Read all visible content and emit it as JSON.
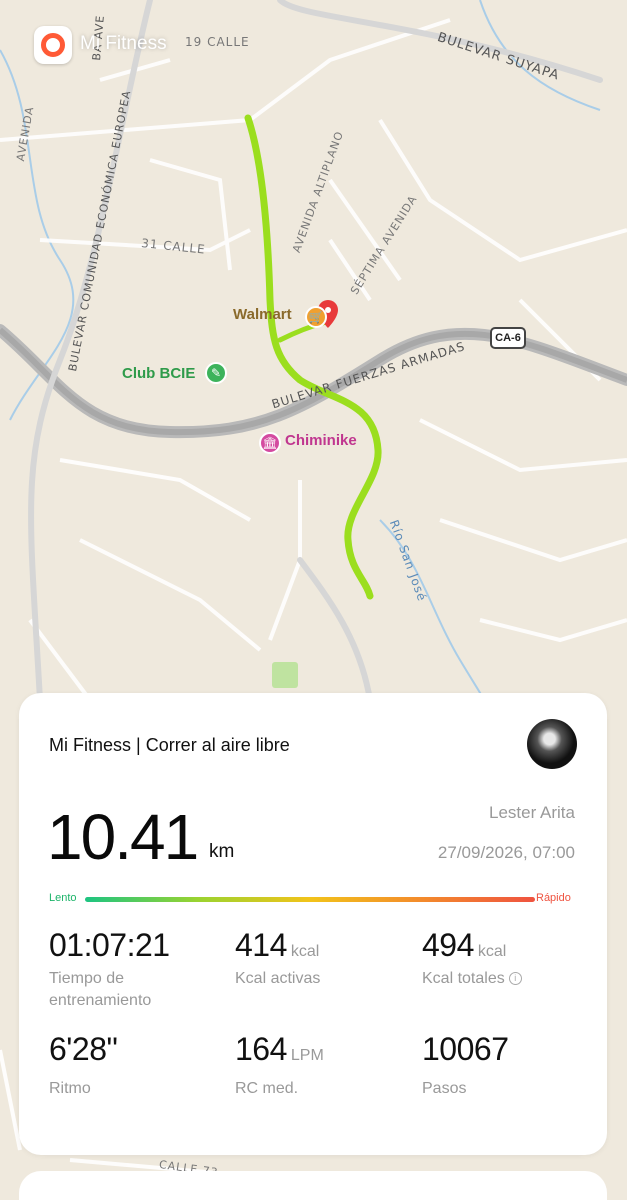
{
  "app": {
    "title": "Mi Fitness"
  },
  "map": {
    "streets": [
      "BULEVAR SUYAPA",
      "19 CALLE",
      "31 CALLE",
      "BULEVAR COMUNIDAD ECONÓMICA EUROPEA",
      "AVENIDA ALTIPLANO",
      "SÉPTIMA AVENIDA",
      "BULEVAR FUERZAS ARMADAS",
      "Río San José",
      "CALLE 73",
      "AVENIDA",
      "BA AVE"
    ],
    "pois": {
      "walmart": "Walmart",
      "club": "Club BCIE",
      "chiminike": "Chiminike"
    },
    "road_shield": "CA-6",
    "route_color": "#a8e02a"
  },
  "workout": {
    "title": "Mi Fitness | Correr al aire libre",
    "distance": "10.41",
    "distance_unit": "km",
    "user": "Lester Arita",
    "datetime": "27/09/2026, 07:00",
    "pace_scale": {
      "low": "Lento",
      "high": "Rápido"
    },
    "metrics": {
      "time": {
        "value": "01:07:21",
        "label": "Tiempo de entrenamiento"
      },
      "active_kcal": {
        "value": "414",
        "unit": "kcal",
        "label": "Kcal activas"
      },
      "total_kcal": {
        "value": "494",
        "unit": "kcal",
        "label": "Kcal totales"
      },
      "pace": {
        "value": "6'28\"",
        "label": "Ritmo"
      },
      "heart_rate": {
        "value": "164",
        "unit": "LPM",
        "label": "RC med."
      },
      "steps": {
        "value": "10067",
        "label": "Pasos"
      }
    }
  }
}
